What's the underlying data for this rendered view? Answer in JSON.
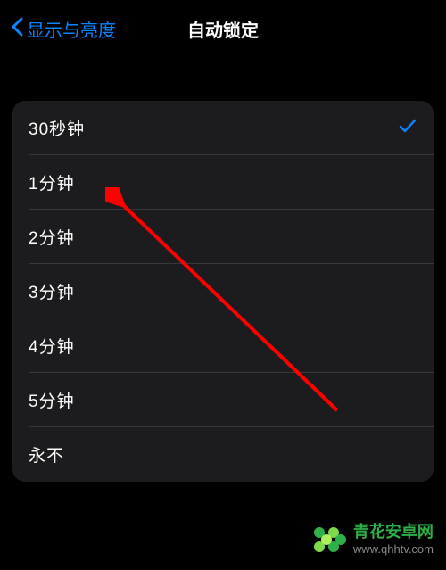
{
  "header": {
    "back_label": "显示与亮度",
    "title": "自动锁定"
  },
  "options": [
    {
      "label": "30秒钟",
      "selected": true
    },
    {
      "label": "1分钟",
      "selected": false
    },
    {
      "label": "2分钟",
      "selected": false
    },
    {
      "label": "3分钟",
      "selected": false
    },
    {
      "label": "4分钟",
      "selected": false
    },
    {
      "label": "5分钟",
      "selected": false
    },
    {
      "label": "永不",
      "selected": false
    }
  ],
  "watermark": {
    "title": "青花安卓网",
    "url": "www.qhhtv.com"
  }
}
